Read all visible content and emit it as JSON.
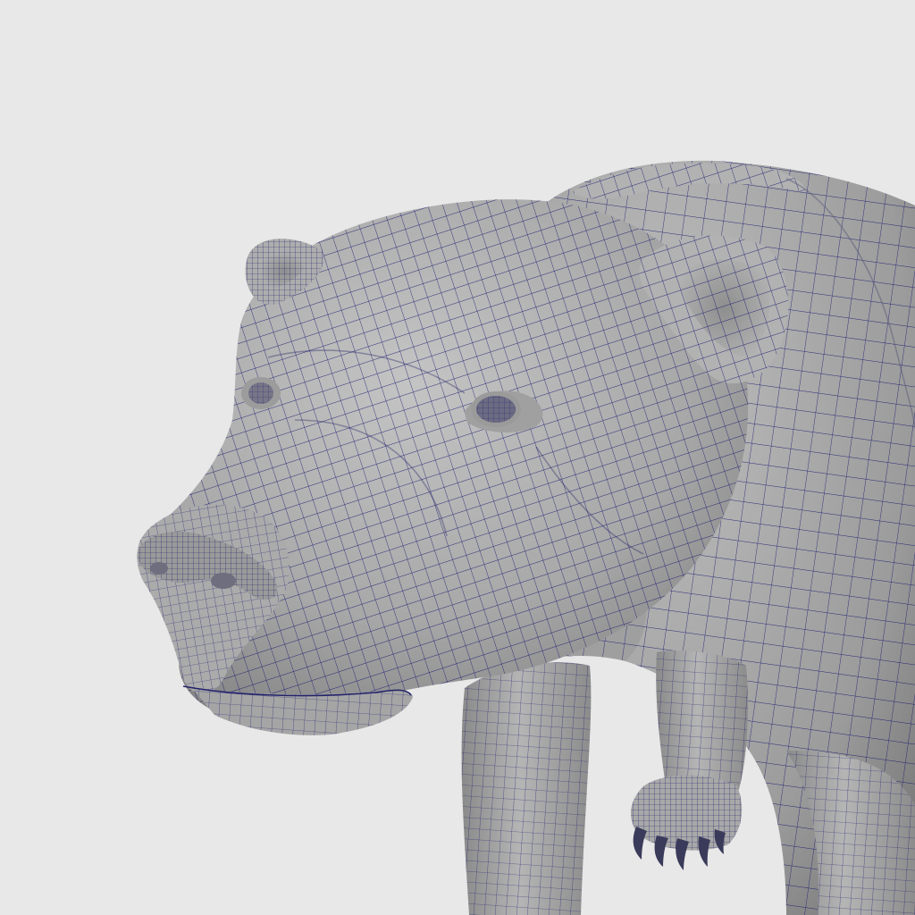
{
  "scene": {
    "subject": "bear-wireframe-model",
    "colors": {
      "background": "#e8e8e8",
      "surface_light": "#b8b8b8",
      "surface_mid": "#a3a3a3",
      "surface_dark": "#7f7f7f",
      "wireframe": "#14146e",
      "claw": "#3a3a5a"
    }
  }
}
